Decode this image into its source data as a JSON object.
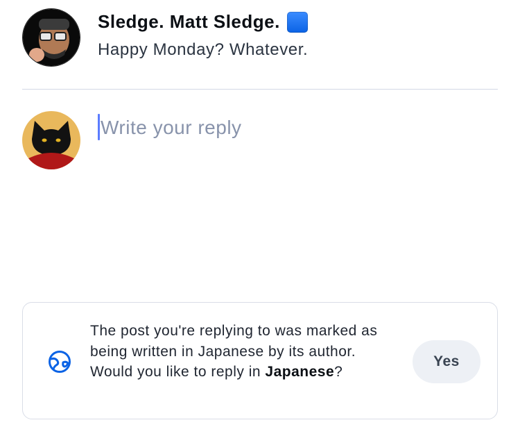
{
  "parent_post": {
    "author_display": "Sledge. Matt Sledge.",
    "author_badge_icon": "blue-square-icon",
    "text": "Happy Monday? Whatever."
  },
  "reply": {
    "placeholder": "Write your reply",
    "value": ""
  },
  "language_prompt": {
    "icon": "globe-icon",
    "text_before": "The post you're replying to was marked as being written in Japanese by its author. Would you like to reply in ",
    "language": "Japanese",
    "text_after": "?",
    "yes_label": "Yes"
  },
  "colors": {
    "accent": "#0b63e5",
    "placeholder": "#8893ab",
    "caret": "#5b7cff",
    "button_bg": "#edf0f5"
  }
}
